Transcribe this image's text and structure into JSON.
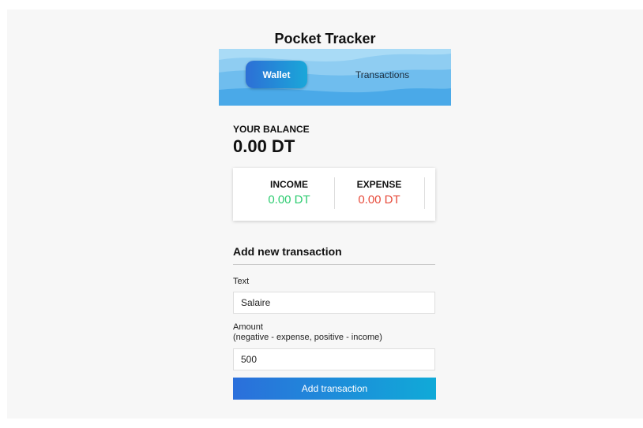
{
  "header": {
    "title": "Pocket Tracker"
  },
  "tabs": [
    {
      "label": "Wallet",
      "active": true
    },
    {
      "label": "Transactions",
      "active": false
    }
  ],
  "balance": {
    "label": "YOUR BALANCE",
    "value": "0.00 DT"
  },
  "summary": {
    "income": {
      "label": "INCOME",
      "value": "0.00 DT"
    },
    "expense": {
      "label": "EXPENSE",
      "value": "0.00 DT"
    }
  },
  "form": {
    "title": "Add new transaction",
    "text_label": "Text",
    "text_value": "Salaire",
    "amount_label": "Amount",
    "amount_hint": "(negative - expense, positive - income)",
    "amount_value": "500",
    "submit_label": "Add transaction"
  },
  "colors": {
    "accent_start": "#2b6fdb",
    "accent_end": "#10aad8",
    "income": "#2ecc71",
    "expense": "#e74c3c",
    "banner": "#7dc2ef"
  }
}
